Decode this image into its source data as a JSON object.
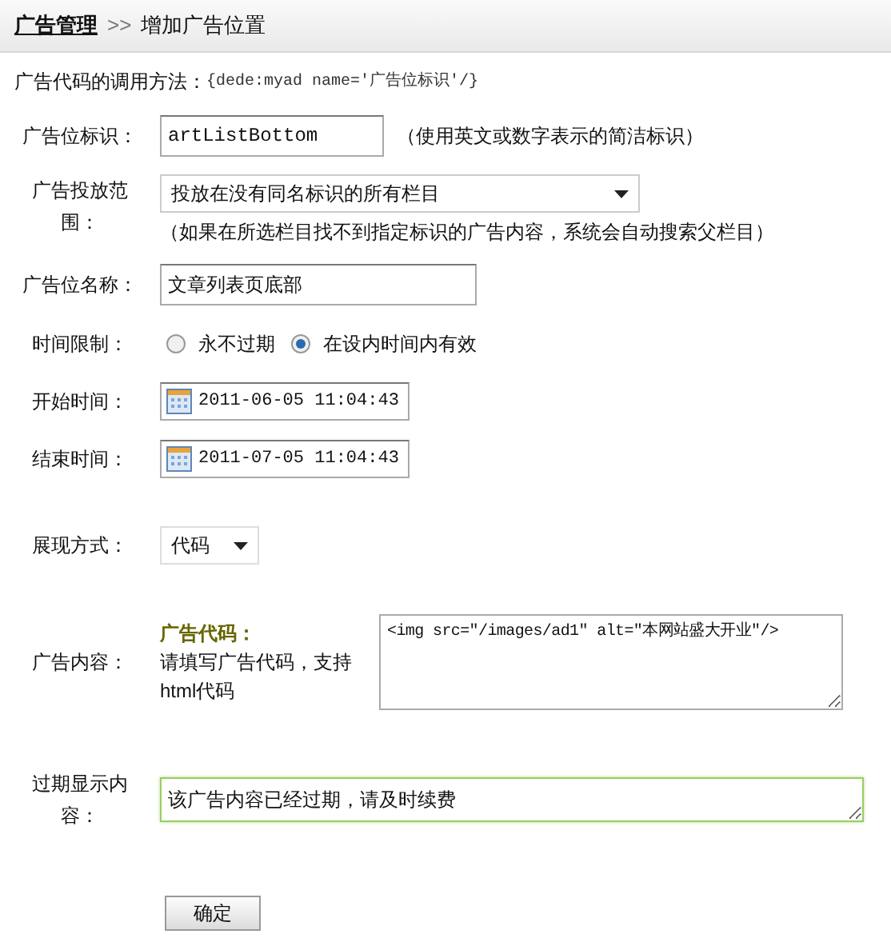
{
  "breadcrumb": {
    "root": "广告管理",
    "separator": ">>",
    "current": "增加广告位置"
  },
  "usage": {
    "label": "广告代码的调用方法：",
    "code": "{dede:myad name='广告位标识'/}"
  },
  "fields": [
    {
      "kind": "text",
      "label": "广告位标识：",
      "value": "artListBottom",
      "note": "（使用英文或数字表示的简洁标识）"
    },
    {
      "kind": "select",
      "label": "广告投放范围：",
      "value": "投放在没有同名标识的所有栏目",
      "note": "（如果在所选栏目找不到指定标识的广告内容，系统会自动搜索父栏目）"
    },
    {
      "kind": "text",
      "label": "广告位名称：",
      "value": "文章列表页底部"
    },
    {
      "kind": "radio",
      "label": "时间限制：",
      "options": [
        {
          "label": "永不过期",
          "selected": false
        },
        {
          "label": "在设内时间内有效",
          "selected": true
        }
      ]
    },
    {
      "kind": "date",
      "label": "开始时间：",
      "value": "2011-06-05 11:04:43"
    },
    {
      "kind": "date",
      "label": "结束时间：",
      "value": "2011-07-05 11:04:43"
    },
    {
      "kind": "small-select",
      "label": "展现方式：",
      "value": "代码"
    },
    {
      "kind": "code",
      "label": "广告内容：",
      "hint_title": "广告代码：",
      "hint": "请填写广告代码，支持html代码",
      "value": "<img src=\"/images/ad1\" alt=\"本网站盛大开业\"/>"
    },
    {
      "kind": "textarea",
      "label": "过期显示内容：",
      "value": "该广告内容已经过期，请及时续费",
      "focused": true
    }
  ],
  "submit": "确定"
}
